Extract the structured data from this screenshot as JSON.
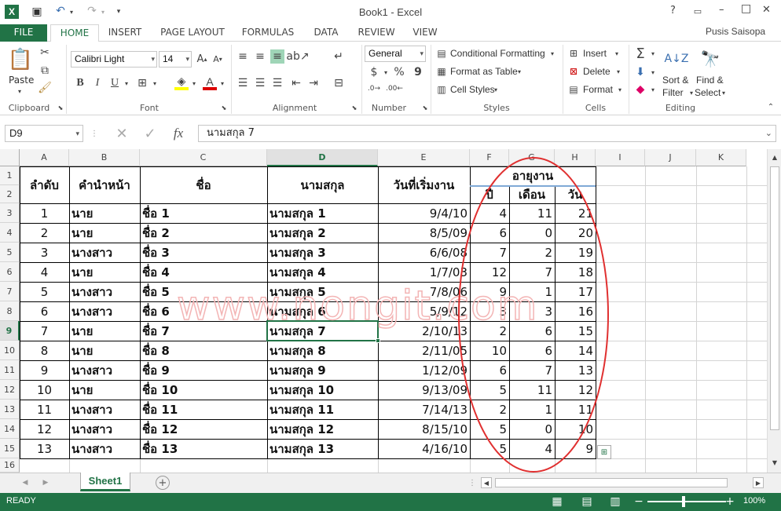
{
  "titlebar": {
    "title": "Book1 - Excel",
    "help": "?",
    "window_controls": [
      "–",
      "□",
      "✕"
    ]
  },
  "ribbon_tabs": [
    "FILE",
    "HOME",
    "INSERT",
    "PAGE LAYOUT",
    "FORMULAS",
    "DATA",
    "REVIEW",
    "VIEW"
  ],
  "active_tab": "HOME",
  "user": "Pusis Saisopa",
  "ribbon": {
    "clipboard": {
      "paste": "Paste",
      "label": "Clipboard"
    },
    "font": {
      "name": "Calibri Light",
      "size": "14",
      "label": "Font",
      "bold": "B",
      "italic": "I",
      "underline": "U"
    },
    "alignment": {
      "label": "Alignment"
    },
    "number": {
      "format": "General",
      "currency": "$",
      "percent": "%",
      "comma": "9",
      "label": "Number"
    },
    "styles": {
      "conditional": "Conditional Formatting",
      "format_table": "Format as Table",
      "cell_styles": "Cell Styles",
      "label": "Styles"
    },
    "cells": {
      "insert": "Insert",
      "delete": "Delete",
      "format": "Format",
      "label": "Cells"
    },
    "editing": {
      "sort_1": "Sort &",
      "sort_2": "Filter",
      "find_1": "Find &",
      "find_2": "Select",
      "label": "Editing"
    }
  },
  "formula_bar": {
    "name_box": "D9",
    "fx": "fx",
    "content": "นามสกุล 7"
  },
  "columns": [
    "A",
    "B",
    "C",
    "D",
    "E",
    "F",
    "G",
    "H",
    "I",
    "J",
    "K"
  ],
  "selected_column": "D",
  "rows": [
    "1",
    "2",
    "3",
    "4",
    "5",
    "6",
    "7",
    "8",
    "9",
    "10",
    "11",
    "12",
    "13",
    "14",
    "15",
    "16"
  ],
  "selected_row": "9",
  "headers": {
    "no": "ลำดับ",
    "prefix": "คำนำหน้า",
    "name": "ชื่อ",
    "surname": "นามสกุล",
    "start": "วันที่เริ่มงาน",
    "tenure": "อายุงาน",
    "years": "ปี",
    "months": "เดือน",
    "days": "วัน"
  },
  "table": [
    [
      "1",
      "นาย",
      "ชื่อ 1",
      "นามสกุล 1",
      "9/4/10",
      "4",
      "11",
      "21"
    ],
    [
      "2",
      "นาย",
      "ชื่อ 2",
      "นามสกุล 2",
      "8/5/09",
      "6",
      "0",
      "20"
    ],
    [
      "3",
      "นางสาว",
      "ชื่อ 3",
      "นามสกุล 3",
      "6/6/08",
      "7",
      "2",
      "19"
    ],
    [
      "4",
      "นาย",
      "ชื่อ 4",
      "นามสกุล 4",
      "1/7/03",
      "12",
      "7",
      "18"
    ],
    [
      "5",
      "นางสาว",
      "ชื่อ 5",
      "นามสกุล 5",
      "7/8/06",
      "9",
      "1",
      "17"
    ],
    [
      "6",
      "นางสาว",
      "ชื่อ 6",
      "นามสกุล 6",
      "5/9/12",
      "3",
      "3",
      "16"
    ],
    [
      "7",
      "นาย",
      "ชื่อ 7",
      "นามสกุล 7",
      "2/10/13",
      "2",
      "6",
      "15"
    ],
    [
      "8",
      "นาย",
      "ชื่อ 8",
      "นามสกุล 8",
      "2/11/05",
      "10",
      "6",
      "14"
    ],
    [
      "9",
      "นางสาว",
      "ชื่อ 9",
      "นามสกุล 9",
      "1/12/09",
      "6",
      "7",
      "13"
    ],
    [
      "10",
      "นาย",
      "ชื่อ 10",
      "นามสกุล 10",
      "9/13/09",
      "5",
      "11",
      "12"
    ],
    [
      "11",
      "นางสาว",
      "ชื่อ 11",
      "นามสกุล 11",
      "7/14/13",
      "2",
      "1",
      "11"
    ],
    [
      "12",
      "นางสาว",
      "ชื่อ 12",
      "นามสกุล 12",
      "8/15/10",
      "5",
      "0",
      "10"
    ],
    [
      "13",
      "นางสาว",
      "ชื่อ 13",
      "นามสกุล 13",
      "4/16/10",
      "5",
      "4",
      "9"
    ]
  ],
  "watermark": "www.nongit.com",
  "sheet_tab": "Sheet1",
  "status": {
    "ready": "READY",
    "zoom": "100%"
  },
  "colors": {
    "excel_green": "#217346",
    "annotation_red": "#e03030",
    "watermark": "#f3b5b5"
  }
}
